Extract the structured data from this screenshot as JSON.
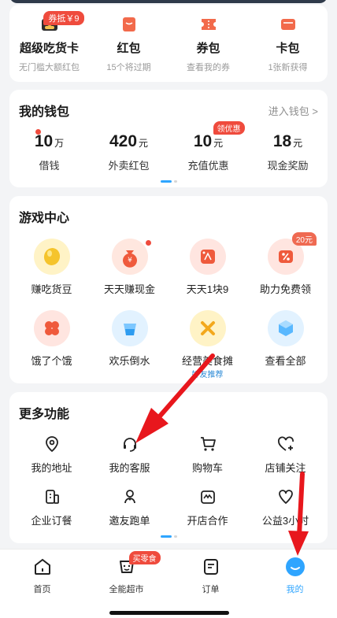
{
  "assets": [
    {
      "title": "超级吃货卡",
      "sub": "无门槛大额红包",
      "badge": "券抵￥9",
      "icon": "card-icon"
    },
    {
      "title": "红包",
      "sub": "15个将过期",
      "icon": "red-envelope-icon"
    },
    {
      "title": "券包",
      "sub": "查看我的券",
      "icon": "coupon-icon"
    },
    {
      "title": "卡包",
      "sub": "1张新获得",
      "icon": "card-pack-icon"
    }
  ],
  "wallet": {
    "title": "我的钱包",
    "link": "进入钱包 >",
    "items": [
      {
        "value": "10",
        "unit": "万",
        "label": "借钱"
      },
      {
        "value": "420",
        "unit": "元",
        "label": "外卖红包"
      },
      {
        "value": "10",
        "unit": "元",
        "label": "充值优惠",
        "badge": "领优惠"
      },
      {
        "value": "18",
        "unit": "元",
        "label": "现金奖励"
      }
    ]
  },
  "games": {
    "title": "游戏中心",
    "items": [
      {
        "label": "赚吃货豆",
        "icon": "bean-icon"
      },
      {
        "label": "天天赚现金",
        "icon": "money-bag-icon"
      },
      {
        "label": "天天1块9",
        "icon": "price-tag-icon"
      },
      {
        "label": "助力免费领",
        "icon": "discount-icon",
        "tag": "20元"
      },
      {
        "label": "饿了个饿",
        "icon": "cells-icon"
      },
      {
        "label": "欢乐倒水",
        "icon": "water-cup-icon"
      },
      {
        "label": "经营美食摊",
        "icon": "food-stall-icon",
        "sub": "好友推荐"
      },
      {
        "label": "查看全部",
        "icon": "cube-icon"
      }
    ]
  },
  "more": {
    "title": "更多功能",
    "items": [
      {
        "label": "我的地址",
        "icon": "location-icon"
      },
      {
        "label": "我的客服",
        "icon": "headset-icon"
      },
      {
        "label": "购物车",
        "icon": "cart-icon"
      },
      {
        "label": "店铺关注",
        "icon": "heart-plus-icon"
      },
      {
        "label": "企业订餐",
        "icon": "building-icon"
      },
      {
        "label": "邀友跑单",
        "icon": "rider-icon"
      },
      {
        "label": "开店合作",
        "icon": "shop-icon"
      },
      {
        "label": "公益3小时",
        "icon": "charity-icon"
      }
    ]
  },
  "tabbar": [
    {
      "label": "首页",
      "icon": "home-icon"
    },
    {
      "label": "全能超市",
      "icon": "supermarket-icon",
      "badge": "买零食"
    },
    {
      "label": "订单",
      "icon": "order-icon"
    },
    {
      "label": "我的",
      "icon": "profile-icon",
      "active": true
    }
  ],
  "colors": {
    "accent": "#2fa5ff",
    "badge": "#ef4b3d",
    "arrow": "#e8171d"
  }
}
